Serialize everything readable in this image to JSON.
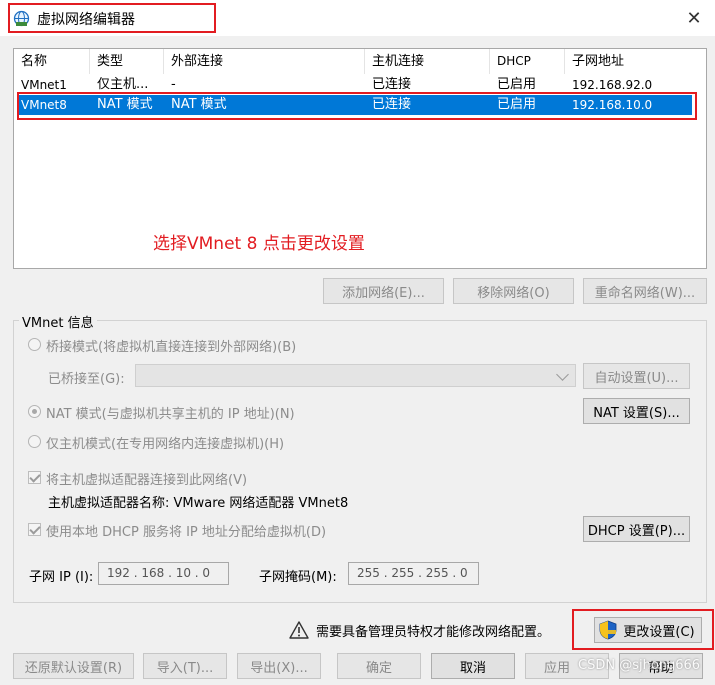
{
  "window": {
    "title": "虚拟网络编辑器",
    "close_glyph": "✕"
  },
  "table": {
    "columns": [
      "名称",
      "类型",
      "外部连接",
      "主机连接",
      "DHCP",
      "子网地址"
    ],
    "rows": [
      {
        "name": "VMnet1",
        "type": "仅主机...",
        "external": "-",
        "host": "已连接",
        "dhcp": "已启用",
        "subnet": "192.168.92.0",
        "selected": false
      },
      {
        "name": "VMnet8",
        "type": "NAT 模式",
        "external": "NAT 模式",
        "host": "已连接",
        "dhcp": "已启用",
        "subnet": "192.168.10.0",
        "selected": true
      }
    ]
  },
  "annotation": "选择VMnet 8 点击更改设置",
  "net_buttons": {
    "add": "添加网络(E)...",
    "remove": "移除网络(O)",
    "rename": "重命名网络(W)..."
  },
  "vmnet_info": {
    "group_label": "VMnet 信息",
    "bridged_label": "桥接模式(将虚拟机直接连接到外部网络)(B)",
    "bridged_to_label": "已桥接至(G):",
    "bridged_to_value": "",
    "auto_settings": "自动设置(U)...",
    "nat_label": "NAT 模式(与虚拟机共享主机的 IP 地址)(N)",
    "nat_settings": "NAT 设置(S)...",
    "hostonly_label": "仅主机模式(在专用网络内连接虚拟机)(H)",
    "connect_adapter_label": "将主机虚拟适配器连接到此网络(V)",
    "adapter_name_text": "主机虚拟适配器名称: VMware 网络适配器 VMnet8",
    "dhcp_label": "使用本地 DHCP 服务将 IP 地址分配给虚拟机(D)",
    "dhcp_settings": "DHCP 设置(P)...",
    "subnet_ip_label": "子网 IP (I):",
    "subnet_ip_value": "192 . 168 . 10  .  0",
    "subnet_mask_label": "子网掩码(M):",
    "subnet_mask_value": "255 . 255 . 255 .  0"
  },
  "admin": {
    "warning_text": "需要具备管理员特权才能修改网络配置。",
    "change_settings": "更改设置(C)"
  },
  "footer": {
    "restore": "还原默认设置(R)",
    "import": "导入(T)...",
    "export": "导出(X)...",
    "ok": "确定",
    "cancel": "取消",
    "apply": "应用",
    "help": "帮助"
  },
  "watermark": "CSDN @sjhong666",
  "colors": {
    "selection": "#0078d7",
    "annotation_red": "#e21c21"
  }
}
